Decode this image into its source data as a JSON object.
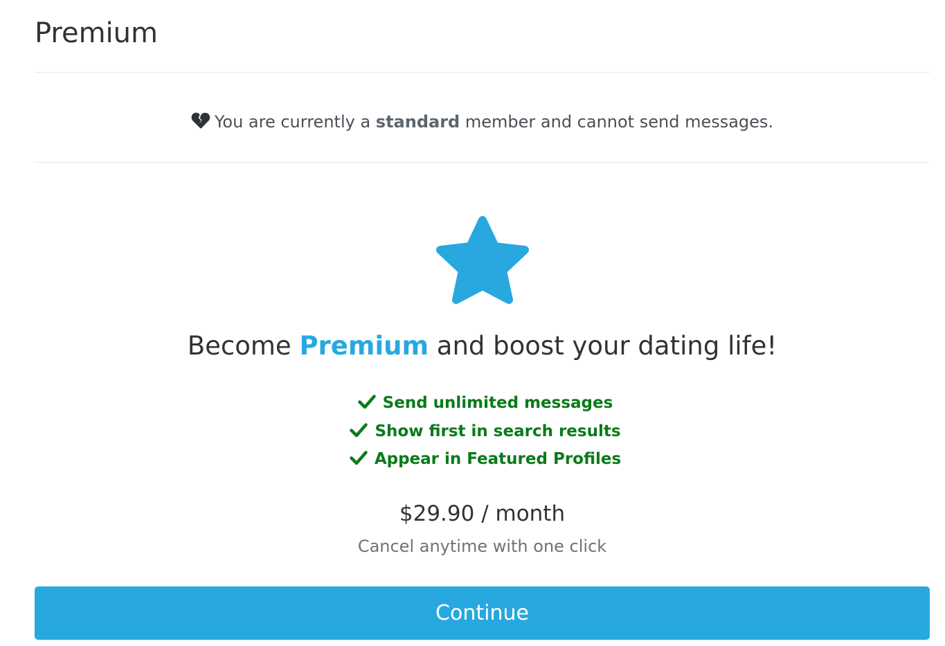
{
  "page": {
    "title": "Premium"
  },
  "notice": {
    "prefix": "You are currently a",
    "membership": "standard",
    "suffix": "member and cannot send messages.",
    "icon": "broken-heart-icon"
  },
  "promo": {
    "icon": "star-icon",
    "headline_prefix": "Become",
    "headline_accent": "Premium",
    "headline_suffix": "and boost your dating life!",
    "features": [
      "Send unlimited messages",
      "Show first in search results",
      "Appear in Featured Profiles"
    ],
    "price": "$29.90 / month",
    "price_note": "Cancel anytime with one click"
  },
  "actions": {
    "continue_label": "Continue"
  },
  "colors": {
    "accent": "#29a8e0",
    "success": "#0a7a1a",
    "text": "#343a40"
  }
}
